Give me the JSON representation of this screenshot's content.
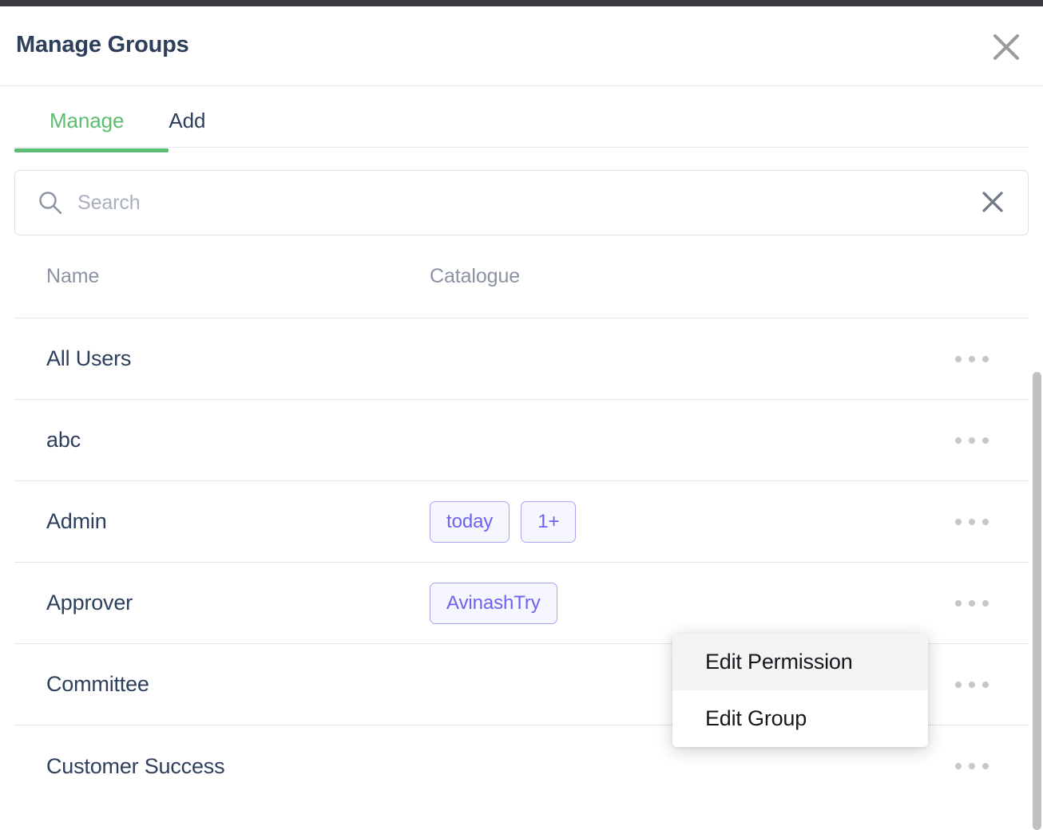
{
  "window": {
    "top_bar_color": "#3a3b3f"
  },
  "header": {
    "title": "Manage Groups",
    "close_icon": "close-icon"
  },
  "tabs": [
    {
      "label": "Manage",
      "active": true
    },
    {
      "label": "Add",
      "active": false
    }
  ],
  "search": {
    "placeholder": "Search",
    "value": "",
    "icon": "search-icon",
    "clear_icon": "close-icon"
  },
  "table": {
    "columns": [
      "Name",
      "Catalogue"
    ],
    "rows": [
      {
        "name": "All Users",
        "catalogue": [],
        "actions": "more-options"
      },
      {
        "name": "abc",
        "catalogue": [],
        "actions": "more-options"
      },
      {
        "name": "Admin",
        "catalogue": [
          "today",
          "1+"
        ],
        "actions": "more-options"
      },
      {
        "name": "Approver",
        "catalogue": [
          "AvinashTry"
        ],
        "actions": "more-options"
      },
      {
        "name": "Committee",
        "catalogue": [],
        "actions": "more-options"
      },
      {
        "name": "Customer Success",
        "catalogue": [],
        "actions": "more-options"
      }
    ]
  },
  "context_menu": {
    "items": [
      {
        "label": "Edit Permission",
        "hovered": true
      },
      {
        "label": "Edit Group",
        "hovered": false
      }
    ]
  },
  "colors": {
    "accent_green": "#5cbc6f",
    "title_navy": "#2e3f5c",
    "chip_text": "#6b63f0",
    "chip_border": "#a9a6f5",
    "chip_bg": "#f6f6fe",
    "muted_text": "#8a93a1",
    "divider": "#e1e4e9",
    "scrollbar": "#c0c0c0"
  }
}
